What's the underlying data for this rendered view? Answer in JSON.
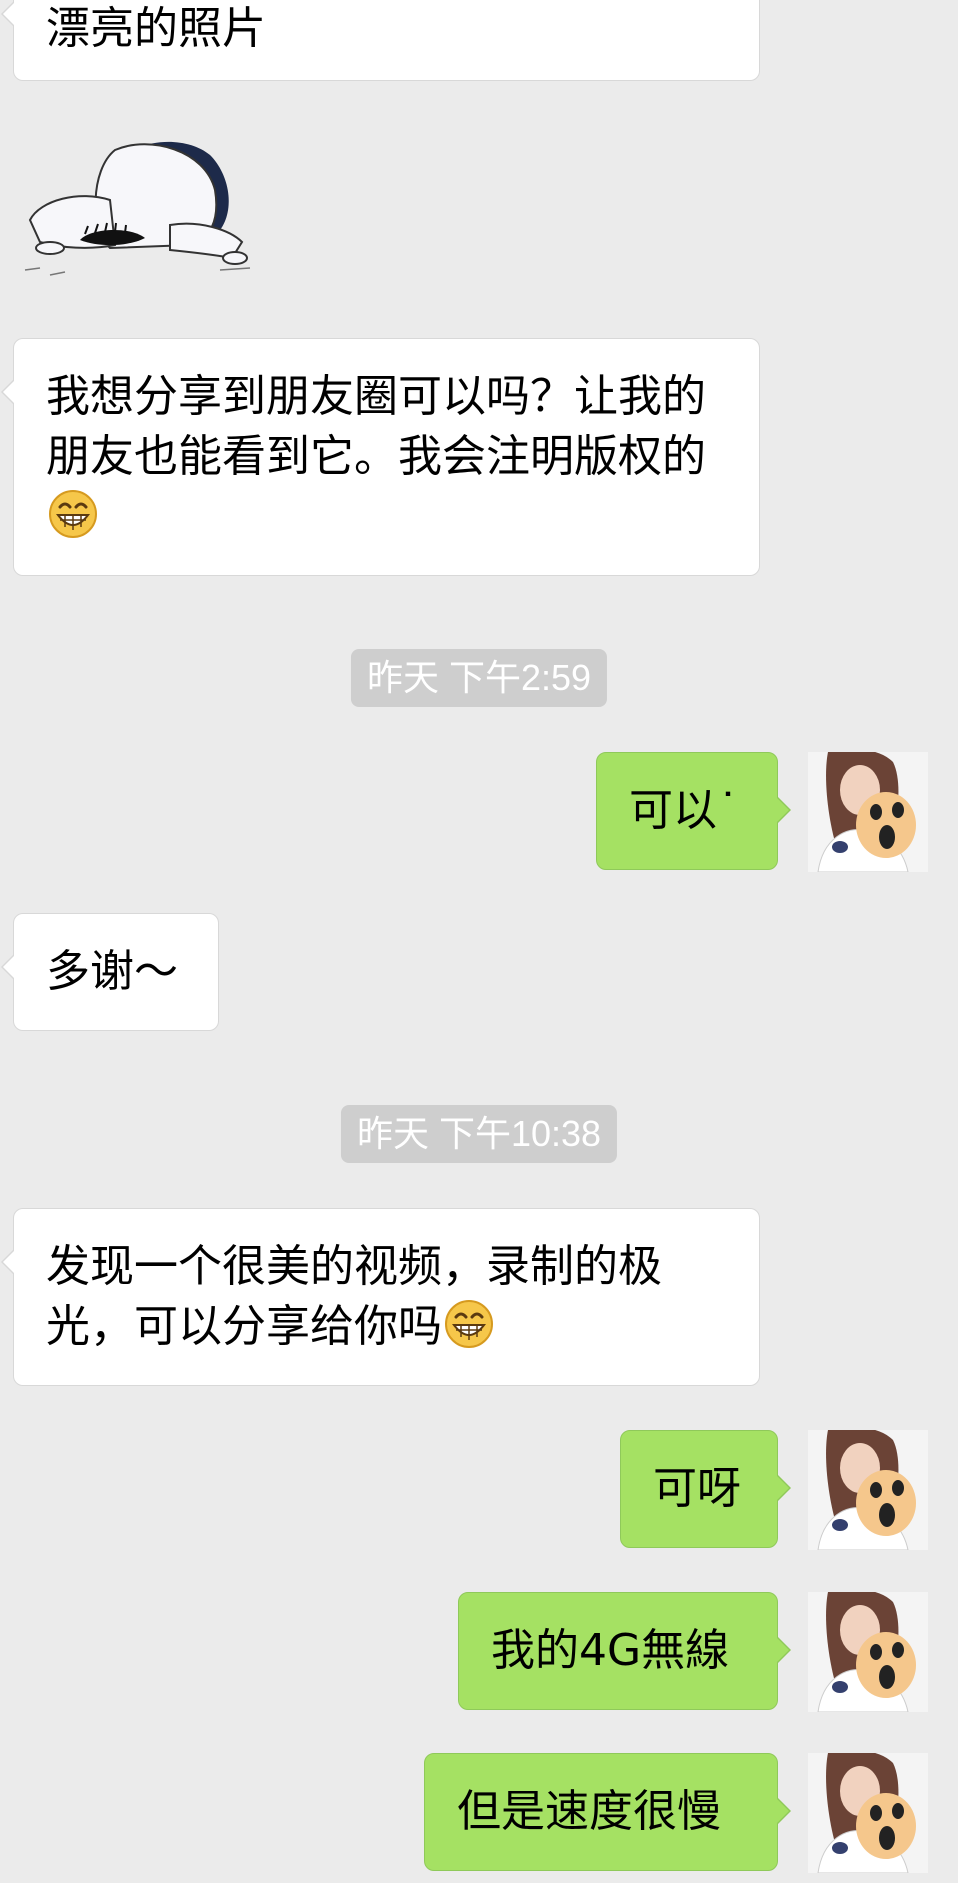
{
  "messages": [
    {
      "side": "left",
      "type": "text",
      "text": "漂亮的照片"
    },
    {
      "side": "left",
      "type": "sticker",
      "sticker": "kneeling-bow-sticker"
    },
    {
      "side": "left",
      "type": "text",
      "text": "我想分享到朋友圈可以吗？让我的朋友也能看到它。我会注明版权的",
      "emoji": "grin-emoji"
    },
    {
      "type": "timestamp",
      "text": "昨天 下午2:59"
    },
    {
      "side": "right",
      "type": "text",
      "text": "可以˙"
    },
    {
      "side": "left",
      "type": "text",
      "text": "多谢～"
    },
    {
      "type": "timestamp",
      "text": "昨天 下午10:38"
    },
    {
      "side": "left",
      "type": "text",
      "text": "发现一个很美的视频，录制的极光，可以分享给你吗",
      "emoji": "grin-emoji"
    },
    {
      "side": "right",
      "type": "text",
      "text": "可呀"
    },
    {
      "side": "right",
      "type": "text",
      "text": "我的4G無線"
    },
    {
      "side": "right",
      "type": "text",
      "text": "但是速度很慢"
    }
  ],
  "colors": {
    "background": "#ebebeb",
    "incoming_bubble": "#ffffff",
    "outgoing_bubble": "#a5e163",
    "timestamp_bg": "#cecece",
    "timestamp_text": "#ffffff"
  },
  "icons": {
    "self_avatar": "avatar-girl-with-surprised-mask-icon",
    "emoji": "grin-emoji"
  }
}
